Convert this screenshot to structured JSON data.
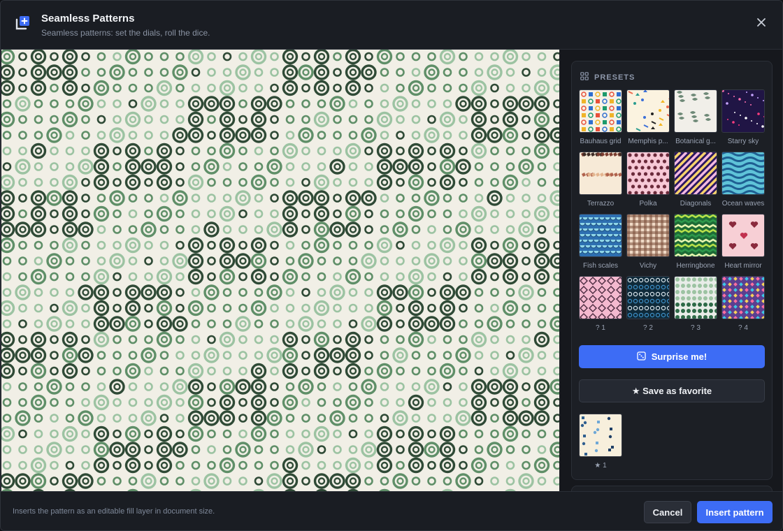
{
  "header": {
    "title": "Seamless Patterns",
    "subtitle": "Seamless patterns: set the dials, roll the dice.",
    "icon": "add-pattern-icon",
    "close_icon": "close-icon"
  },
  "colors": {
    "accent": "#3d6cf5",
    "canvas_bg": "#f1efe6",
    "ring_dark": "#2f4a36",
    "ring_mid": "#5f8f68",
    "ring_light": "#9cc3a2"
  },
  "presets": {
    "heading": "PRESETS",
    "items": [
      {
        "label": "Bauhaus grid",
        "key": "bauhaus"
      },
      {
        "label": "Memphis p...",
        "key": "memphis"
      },
      {
        "label": "Botanical g...",
        "key": "botanical"
      },
      {
        "label": "Starry sky",
        "key": "starry"
      },
      {
        "label": "Terrazzo",
        "key": "terrazzo"
      },
      {
        "label": "Polka",
        "key": "polka"
      },
      {
        "label": "Diagonals",
        "key": "diagonals"
      },
      {
        "label": "Ocean waves",
        "key": "waves"
      },
      {
        "label": "Fish scales",
        "key": "fish"
      },
      {
        "label": "Vichy",
        "key": "vichy"
      },
      {
        "label": "Herringbone",
        "key": "herringbone"
      },
      {
        "label": "Heart mirror",
        "key": "heart"
      },
      {
        "label": "? 1",
        "key": "random1"
      },
      {
        "label": "? 2",
        "key": "random2"
      },
      {
        "label": "? 3",
        "key": "random3"
      },
      {
        "label": "? 4",
        "key": "random4"
      }
    ]
  },
  "actions": {
    "surprise_label": "Surprise me!",
    "surprise_icon": "dice-icon",
    "favorite_label": "★ Save as favorite"
  },
  "favorites": [
    {
      "label": "★ 1"
    }
  ],
  "footer": {
    "note": "Inserts the pattern as an editable fill layer in document size.",
    "cancel_label": "Cancel",
    "insert_label": "Insert pattern"
  }
}
